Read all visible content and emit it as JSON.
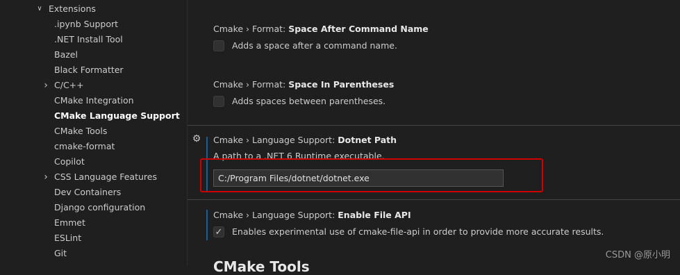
{
  "sidebar": {
    "items": [
      {
        "label": "Extensions",
        "chevron": "∨"
      },
      {
        "label": ".ipynb Support"
      },
      {
        "label": ".NET Install Tool"
      },
      {
        "label": "Bazel"
      },
      {
        "label": "Black Formatter"
      },
      {
        "label": "C/C++",
        "chevron": "›"
      },
      {
        "label": "CMake Integration"
      },
      {
        "label": "CMake Language Support",
        "active": true
      },
      {
        "label": "CMake Tools"
      },
      {
        "label": "cmake-format"
      },
      {
        "label": "Copilot"
      },
      {
        "label": "CSS Language Features",
        "chevron": "›"
      },
      {
        "label": "Dev Containers"
      },
      {
        "label": "Django configuration"
      },
      {
        "label": "Emmet"
      },
      {
        "label": "ESLint"
      },
      {
        "label": "Git"
      }
    ]
  },
  "settings": [
    {
      "category": "Cmake › Format: ",
      "name": "Space After Command Name",
      "description": "Adds a space after a command name.",
      "checked": false
    },
    {
      "category": "Cmake › Format: ",
      "name": "Space In Parentheses",
      "description": "Adds spaces between parentheses.",
      "checked": false
    },
    {
      "category": "Cmake › Language Support: ",
      "name": "Dotnet Path",
      "description": "A path to a .NET 6 Runtime executable.",
      "value": "C:/Program Files/dotnet/dotnet.exe"
    },
    {
      "category": "Cmake › Language Support: ",
      "name": "Enable File API",
      "description": "Enables experimental use of cmake-file-api in order to provide more accurate results.",
      "checked": true
    }
  ],
  "icons": {
    "gear": "gear-icon",
    "check": "✓"
  },
  "next_section": "CMake Tools",
  "watermark": "CSDN @原小明",
  "colors": {
    "accent": "#0e639c",
    "annotation": "#d00000"
  }
}
